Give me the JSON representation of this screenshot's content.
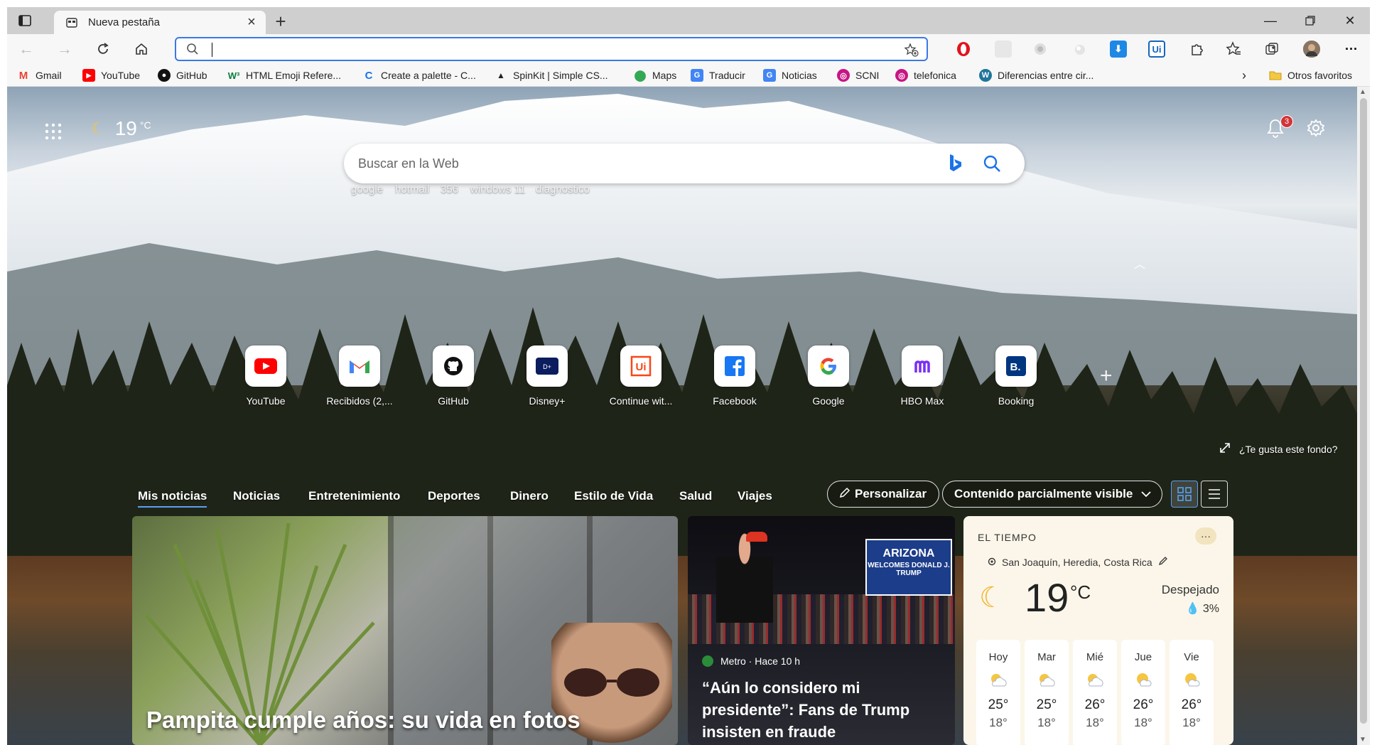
{
  "window": {
    "tab_title": "Nueva pestaña"
  },
  "toolbar": {
    "address_value": "",
    "extensions": [
      "opera-icon",
      "blank-extension-icon",
      "blank-extension-icon-2",
      "blank-extension-icon-3",
      "download-icon",
      "uipath-icon",
      "puzzle-icon",
      "favorites-icon",
      "collections-icon",
      "profile-avatar",
      "more-icon"
    ]
  },
  "bookmarks": {
    "items": [
      {
        "label": "Gmail",
        "icon": "gmail-icon",
        "color": "#ea4335"
      },
      {
        "label": "YouTube",
        "icon": "youtube-icon",
        "color": "#ff0000"
      },
      {
        "label": "GitHub",
        "icon": "github-icon",
        "color": "#111111"
      },
      {
        "label": "HTML Emoji Refere...",
        "icon": "w3-icon",
        "color": "#0a7d3e"
      },
      {
        "label": "Create a palette - C...",
        "icon": "c-icon",
        "color": "#1a73e8"
      },
      {
        "label": "SpinKit | Simple CS...",
        "icon": "spinkit-icon",
        "color": "#222222"
      },
      {
        "label": "Maps",
        "icon": "maps-icon",
        "color": "#34a853"
      },
      {
        "label": "Traducir",
        "icon": "translate-icon",
        "color": "#4285f4"
      },
      {
        "label": "Noticias",
        "icon": "news-icon",
        "color": "#4285f4"
      },
      {
        "label": "SCNI",
        "icon": "scni-icon",
        "color": "#c71585"
      },
      {
        "label": "telefonica",
        "icon": "telefonica-icon",
        "color": "#c71585"
      },
      {
        "label": "Diferencias entre cir...",
        "icon": "wordpress-icon",
        "color": "#21759b"
      }
    ],
    "other_favorites": "Otros favoritos"
  },
  "page": {
    "weather_mini": {
      "temp": "19",
      "unit": "°C"
    },
    "notifications_count": "3",
    "search": {
      "placeholder": "Buscar en la Web",
      "suggestions": [
        "google",
        "hotmail",
        "356",
        "windows 11",
        "diagnostico"
      ]
    },
    "quick_links": [
      {
        "label": "YouTube",
        "icon": "youtube-icon"
      },
      {
        "label": "Recibidos (2,...",
        "icon": "gmail-icon"
      },
      {
        "label": "GitHub",
        "icon": "github-icon"
      },
      {
        "label": "Disney+",
        "icon": "disney-icon"
      },
      {
        "label": "Continue wit...",
        "icon": "uipath-icon"
      },
      {
        "label": "Facebook",
        "icon": "facebook-icon"
      },
      {
        "label": "Google",
        "icon": "google-icon"
      },
      {
        "label": "HBO Max",
        "icon": "hbomax-icon"
      },
      {
        "label": "Booking",
        "icon": "booking-icon"
      }
    ],
    "background_question": "¿Te gusta este fondo?",
    "news_tabs": [
      "Mis noticias",
      "Noticias",
      "Entretenimiento",
      "Deportes",
      "Dinero",
      "Estilo de Vida",
      "Salud",
      "Viajes"
    ],
    "personalize": "Personalizar",
    "visibility": "Contenido parcialmente visible",
    "cards": {
      "main_headline": "Pampita cumple años: su vida en fotos",
      "secondary": {
        "source": "Metro · Hace 10 h",
        "headline": "“Aún lo considero mi presidente”: Fans de Trump insisten en fraude",
        "sign_title": "ARIZONA",
        "sign_sub": "WELCOMES DONALD J. TRUMP"
      }
    },
    "weather_card": {
      "header": "EL TIEMPO",
      "location": "San Joaquín, Heredia, Costa Rica",
      "temp": "19",
      "unit": "°C",
      "condition": "Despejado",
      "precip": "3%",
      "forecast": [
        {
          "day": "Hoy",
          "hi": "25°",
          "lo": "18°"
        },
        {
          "day": "Mar",
          "hi": "25°",
          "lo": "18°"
        },
        {
          "day": "Mié",
          "hi": "26°",
          "lo": "18°"
        },
        {
          "day": "Jue",
          "hi": "26°",
          "lo": "18°"
        },
        {
          "day": "Vie",
          "hi": "26°",
          "lo": "18°"
        }
      ]
    }
  }
}
